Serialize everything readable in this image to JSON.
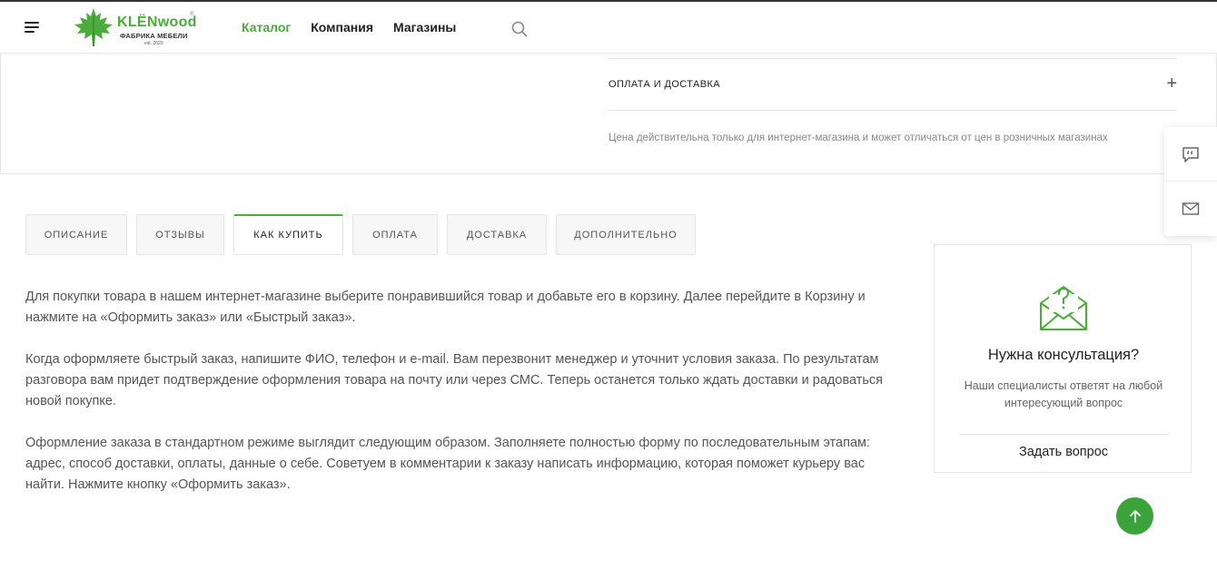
{
  "header": {
    "brand": "KLЁNwood",
    "brand_reg": "®",
    "brand_sub": "ФАБРИКА МЕБЕЛИ",
    "brand_est": "est. 2020",
    "nav": [
      {
        "label": "Каталог",
        "active": true
      },
      {
        "label": "Компания",
        "active": false
      },
      {
        "label": "Магазины",
        "active": false
      }
    ],
    "icons": [
      "menu-icon",
      "search-icon"
    ]
  },
  "accordion": {
    "title": "ОПЛАТА И ДОСТАВКА",
    "toggle": "+",
    "price_note": "Цена действительна только для интернет-магазина и может отличаться от цен в розничных магазинах"
  },
  "side_widgets": [
    "chat-quote-icon",
    "mail-icon"
  ],
  "tabs": [
    {
      "label": "ОПИСАНИЕ",
      "active": false
    },
    {
      "label": "ОТЗЫВЫ",
      "active": false
    },
    {
      "label": "КАК КУПИТЬ",
      "active": true
    },
    {
      "label": "ОПЛАТА",
      "active": false
    },
    {
      "label": "ДОСТАВКА",
      "active": false
    },
    {
      "label": "ДОПОЛНИТЕЛЬНО",
      "active": false
    }
  ],
  "content": {
    "paragraphs": [
      "Для покупки товара в нашем интернет-магазине выберите понравившийся товар и добавьте его в корзину. Далее перейдите в Корзину и нажмите на «Оформить заказ» или «Быстрый заказ».",
      "Когда оформляете быстрый заказ, напишите ФИО, телефон и e-mail. Вам перезвонит менеджер и уточнит условия заказа. По результатам разговора вам придет подтверждение оформления товара на почту или через СМС. Теперь останется только ждать доставки и радоваться новой покупке.",
      "Оформление заказа в стандартном режиме выглядит следующим образом. Заполняете полностью форму по последовательным этапам: адрес, способ доставки, оплаты, данные о себе. Советуем в комментарии к заказу написать информацию, которая поможет курьеру вас найти. Нажмите кнопку «Оформить заказ»."
    ]
  },
  "consult": {
    "icon": "question-envelope-icon",
    "title": "Нужна консультация?",
    "desc": "Наши специалисты ответят на любой интересующий вопрос",
    "link": "Задать вопрос"
  },
  "scroll_top": {
    "icon": "arrow-up-icon"
  },
  "colors": {
    "accent": "#4bab3b",
    "scroll_btn": "#3aa33a",
    "text": "#555555"
  }
}
